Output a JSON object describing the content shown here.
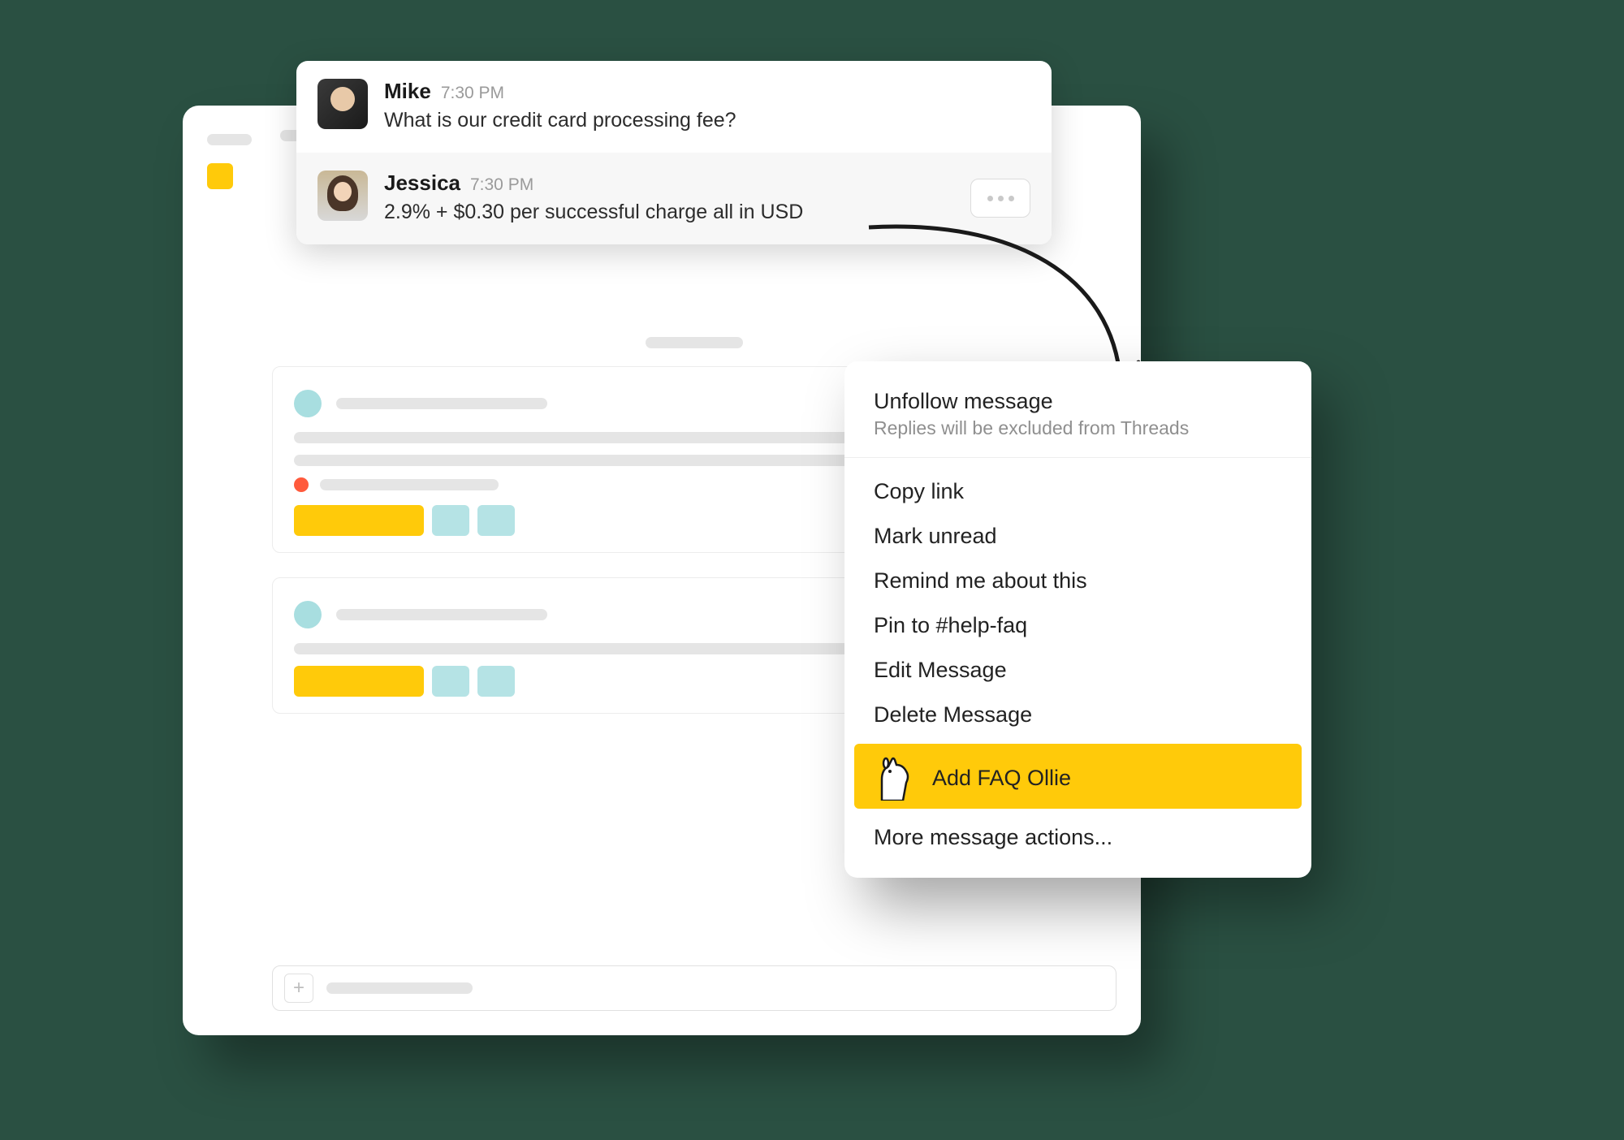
{
  "messages": [
    {
      "name": "Mike",
      "time": "7:30 PM",
      "text": "What is our credit card processing fee?"
    },
    {
      "name": "Jessica",
      "time": "7:30 PM",
      "text": "2.9%  + $0.30 per successful charge all in USD"
    }
  ],
  "context_menu": {
    "unfollow_title": "Unfollow message",
    "unfollow_sub": "Replies will be excluded from Threads",
    "items": [
      "Copy link",
      "Mark unread",
      "Remind me about this",
      "Pin to #help-faq",
      "Edit Message",
      "Delete Message"
    ],
    "highlight": "Add FAQ Ollie",
    "more": "More message actions..."
  }
}
